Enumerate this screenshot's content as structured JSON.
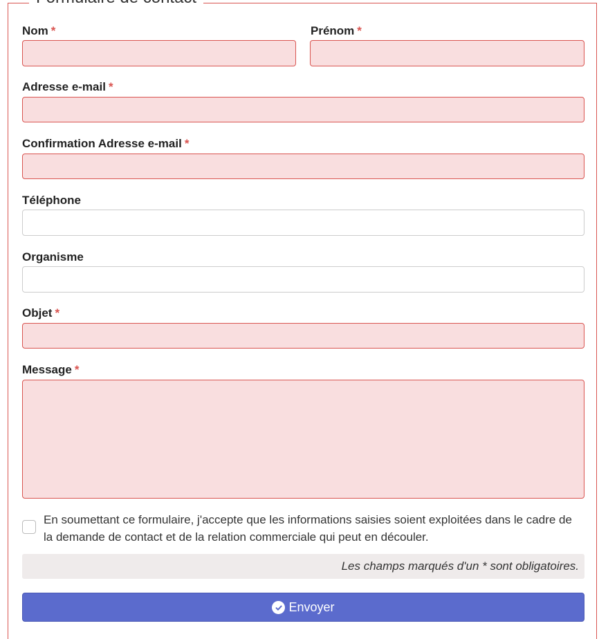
{
  "form": {
    "legend": "Formulaire de contact",
    "required_marker": "*",
    "fields": {
      "nom": {
        "label": "Nom",
        "value": "",
        "required": true
      },
      "prenom": {
        "label": "Prénom",
        "value": "",
        "required": true
      },
      "email": {
        "label": "Adresse e-mail",
        "value": "",
        "required": true
      },
      "email_confirm": {
        "label": "Confirmation Adresse e-mail",
        "value": "",
        "required": true
      },
      "telephone": {
        "label": "Téléphone",
        "value": "",
        "required": false
      },
      "organisme": {
        "label": "Organisme",
        "value": "",
        "required": false
      },
      "objet": {
        "label": "Objet",
        "value": "",
        "required": true
      },
      "message": {
        "label": "Message",
        "value": "",
        "required": true
      }
    },
    "consent": {
      "text": "En soumettant ce formulaire, j'accepte que les informations saisies soient exploitées dans le cadre de la demande de contact et de la relation commerciale qui peut en découler.",
      "checked": false
    },
    "required_note": "Les champs marqués d'un * sont obligatoires.",
    "submit_label": "Envoyer",
    "submit_icon": "check-circle-icon"
  },
  "colors": {
    "error_border": "#d9534f",
    "error_background": "#f9dedf",
    "required_asterisk": "#d9534f",
    "submit_background": "#5b6bcd",
    "note_background": "#efebeb"
  }
}
